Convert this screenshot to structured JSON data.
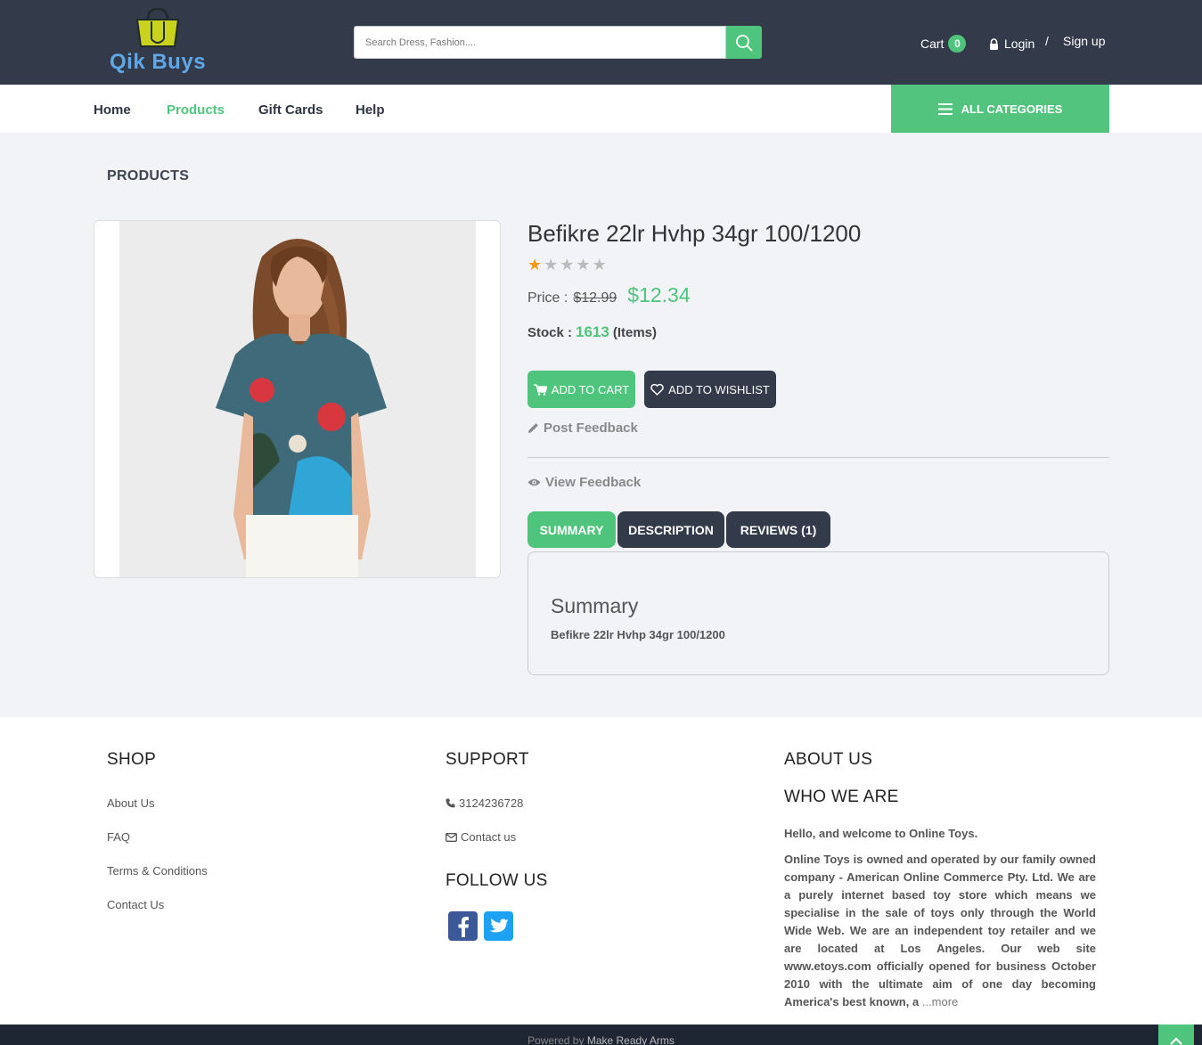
{
  "brand": {
    "name": "Qik Buys"
  },
  "header": {
    "search_placeholder": "Search Dress, Fashion....",
    "cart_label": "Cart",
    "cart_count": "0",
    "login_label": "Login",
    "separator": "/",
    "signup_label": "Sign up"
  },
  "nav": {
    "items": [
      {
        "label": "Home"
      },
      {
        "label": "Products"
      },
      {
        "label": "Gift Cards"
      },
      {
        "label": "Help"
      }
    ],
    "all_categories": "ALL CATEGORIES"
  },
  "page": {
    "section_title": "PRODUCTS"
  },
  "product": {
    "title": "Befikre 22lr Hvhp 34gr 100/1200",
    "rating": 1,
    "rating_max": 5,
    "price_label": "Price :",
    "price_old": "$12.99",
    "price_new": "$12.34",
    "stock_label": "Stock :",
    "stock_value": "1613",
    "stock_unit": "(Items)",
    "add_to_cart": "ADD TO CART",
    "add_to_wishlist": "ADD TO WISHLIST",
    "post_feedback": "Post Feedback",
    "view_feedback": "View Feedback"
  },
  "tabs": {
    "summary": "SUMMARY",
    "description": "DESCRIPTION",
    "reviews": "REVIEWS (1)",
    "panel_heading": "Summary",
    "panel_text": "Befikre 22lr Hvhp 34gr 100/1200"
  },
  "footer": {
    "shop": {
      "heading": "SHOP",
      "links": [
        "About Us",
        "FAQ",
        "Terms & Conditions",
        "Contact Us"
      ]
    },
    "support": {
      "heading": "SUPPORT",
      "phone": "3124236728",
      "contact": "Contact us"
    },
    "follow": {
      "heading": "FOLLOW US"
    },
    "about": {
      "heading": "ABOUT US",
      "subheading": "WHO WE ARE",
      "welcome": "Hello, and welcome to Online Toys.",
      "paragraph": "Online Toys is owned and operated by our family owned company - American Online Commerce Pty. Ltd. We are a purely internet based toy store which means we specialise in the sale of toys only through the World Wide Web. We are an independent toy retailer and we are located at Los Angeles. Our web site www.etoys.com officially opened for business October 2010 with the ultimate aim of one day becoming America's best known, a",
      "more": "...more"
    },
    "powered_by": "Powered by",
    "powered_by_name": "Make Ready Arms"
  },
  "colors": {
    "header_bg": "#333a4a",
    "accent_green": "#4fc47d",
    "page_bg": "#f2f3f7",
    "star": "#f39c12"
  }
}
